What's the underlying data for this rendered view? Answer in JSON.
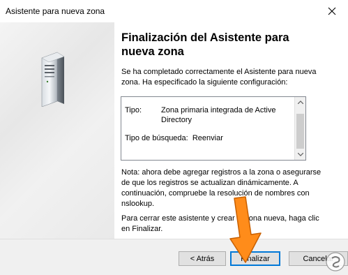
{
  "window": {
    "title": "Asistente para nueva zona"
  },
  "main": {
    "heading_line1": "Finalización del Asistente para",
    "heading_line2": "nueva zona",
    "intro": "Se ha completado correctamente el Asistente para nueva zona. Ha especificado la siguiente configuración:",
    "summary": {
      "type_label": "Tipo:",
      "type_value": "Zona primaria integrada de Active Directory",
      "lookup_label": "Tipo de búsqueda:",
      "lookup_value": "Reenviar"
    },
    "note": "Nota: ahora debe agregar registros a la zona o asegurarse de que los registros se actualizan dinámicamente. A continuación, compruebe la resolución de nombres con nslookup.",
    "closing": "Para cerrar este asistente y crear la zona nueva, haga clic en Finalizar."
  },
  "footer": {
    "back_label": "< Atrás",
    "finish_label": "Finalizar",
    "cancel_label": "Cancelar"
  },
  "icons": {
    "close": "close-icon",
    "server": "server-icon",
    "annotation": "orange-arrow",
    "watermark": "logo-watermark"
  },
  "colors": {
    "accent": "#0078d7",
    "arrow": "#ff8c1a"
  }
}
